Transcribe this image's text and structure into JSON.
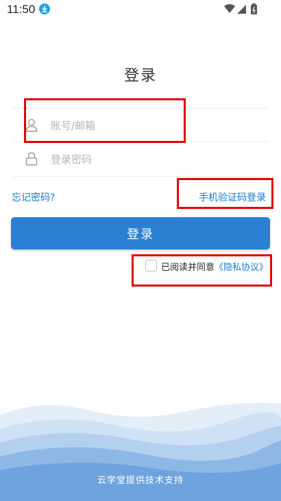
{
  "status_bar": {
    "time": "11:50"
  },
  "title": "登录",
  "account": {
    "placeholder": "账号/邮箱"
  },
  "password": {
    "placeholder": "登录密码"
  },
  "links": {
    "forgot": "忘记密码?",
    "sms_login": "手机验证码登录"
  },
  "login_button": "登录",
  "agreement": {
    "text": "已阅读并同意",
    "policy": "《隐私协议》",
    "checked": false
  },
  "footer": "云学堂提供技术支持",
  "colors": {
    "accent": "#2b80d3",
    "link": "#1b78c8",
    "highlight": "#e50000"
  }
}
